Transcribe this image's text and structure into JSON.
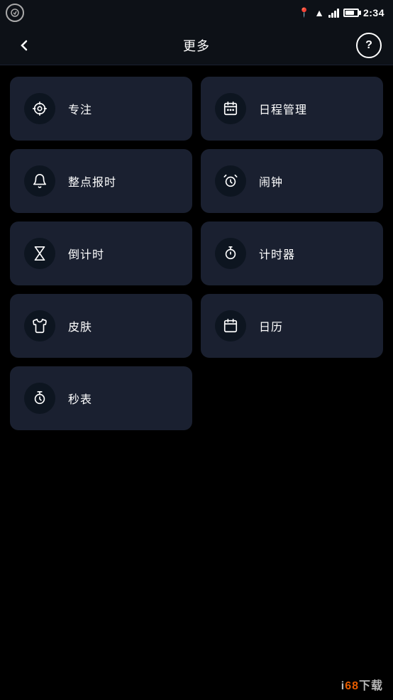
{
  "statusBar": {
    "time": "2:34",
    "appIcon": "FYN"
  },
  "header": {
    "backLabel": "‹",
    "title": "更多",
    "helpLabel": "?"
  },
  "menuItems": [
    {
      "id": "focus",
      "label": "专注",
      "icon": "focus"
    },
    {
      "id": "schedule",
      "label": "日程管理",
      "icon": "calendar-list"
    },
    {
      "id": "hourly-chime",
      "label": "整点报时",
      "icon": "bell"
    },
    {
      "id": "alarm",
      "label": "闹钟",
      "icon": "alarm"
    },
    {
      "id": "countdown",
      "label": "倒计时",
      "icon": "hourglass"
    },
    {
      "id": "timer",
      "label": "计时器",
      "icon": "stopwatch"
    },
    {
      "id": "skin",
      "label": "皮肤",
      "icon": "tshirt"
    },
    {
      "id": "calendar",
      "label": "日历",
      "icon": "calendar"
    },
    {
      "id": "stopwatch",
      "label": "秒表",
      "icon": "stopwatch2"
    }
  ],
  "watermark": {
    "prefix": "i",
    "highlight": "68",
    "suffix": "下载"
  }
}
